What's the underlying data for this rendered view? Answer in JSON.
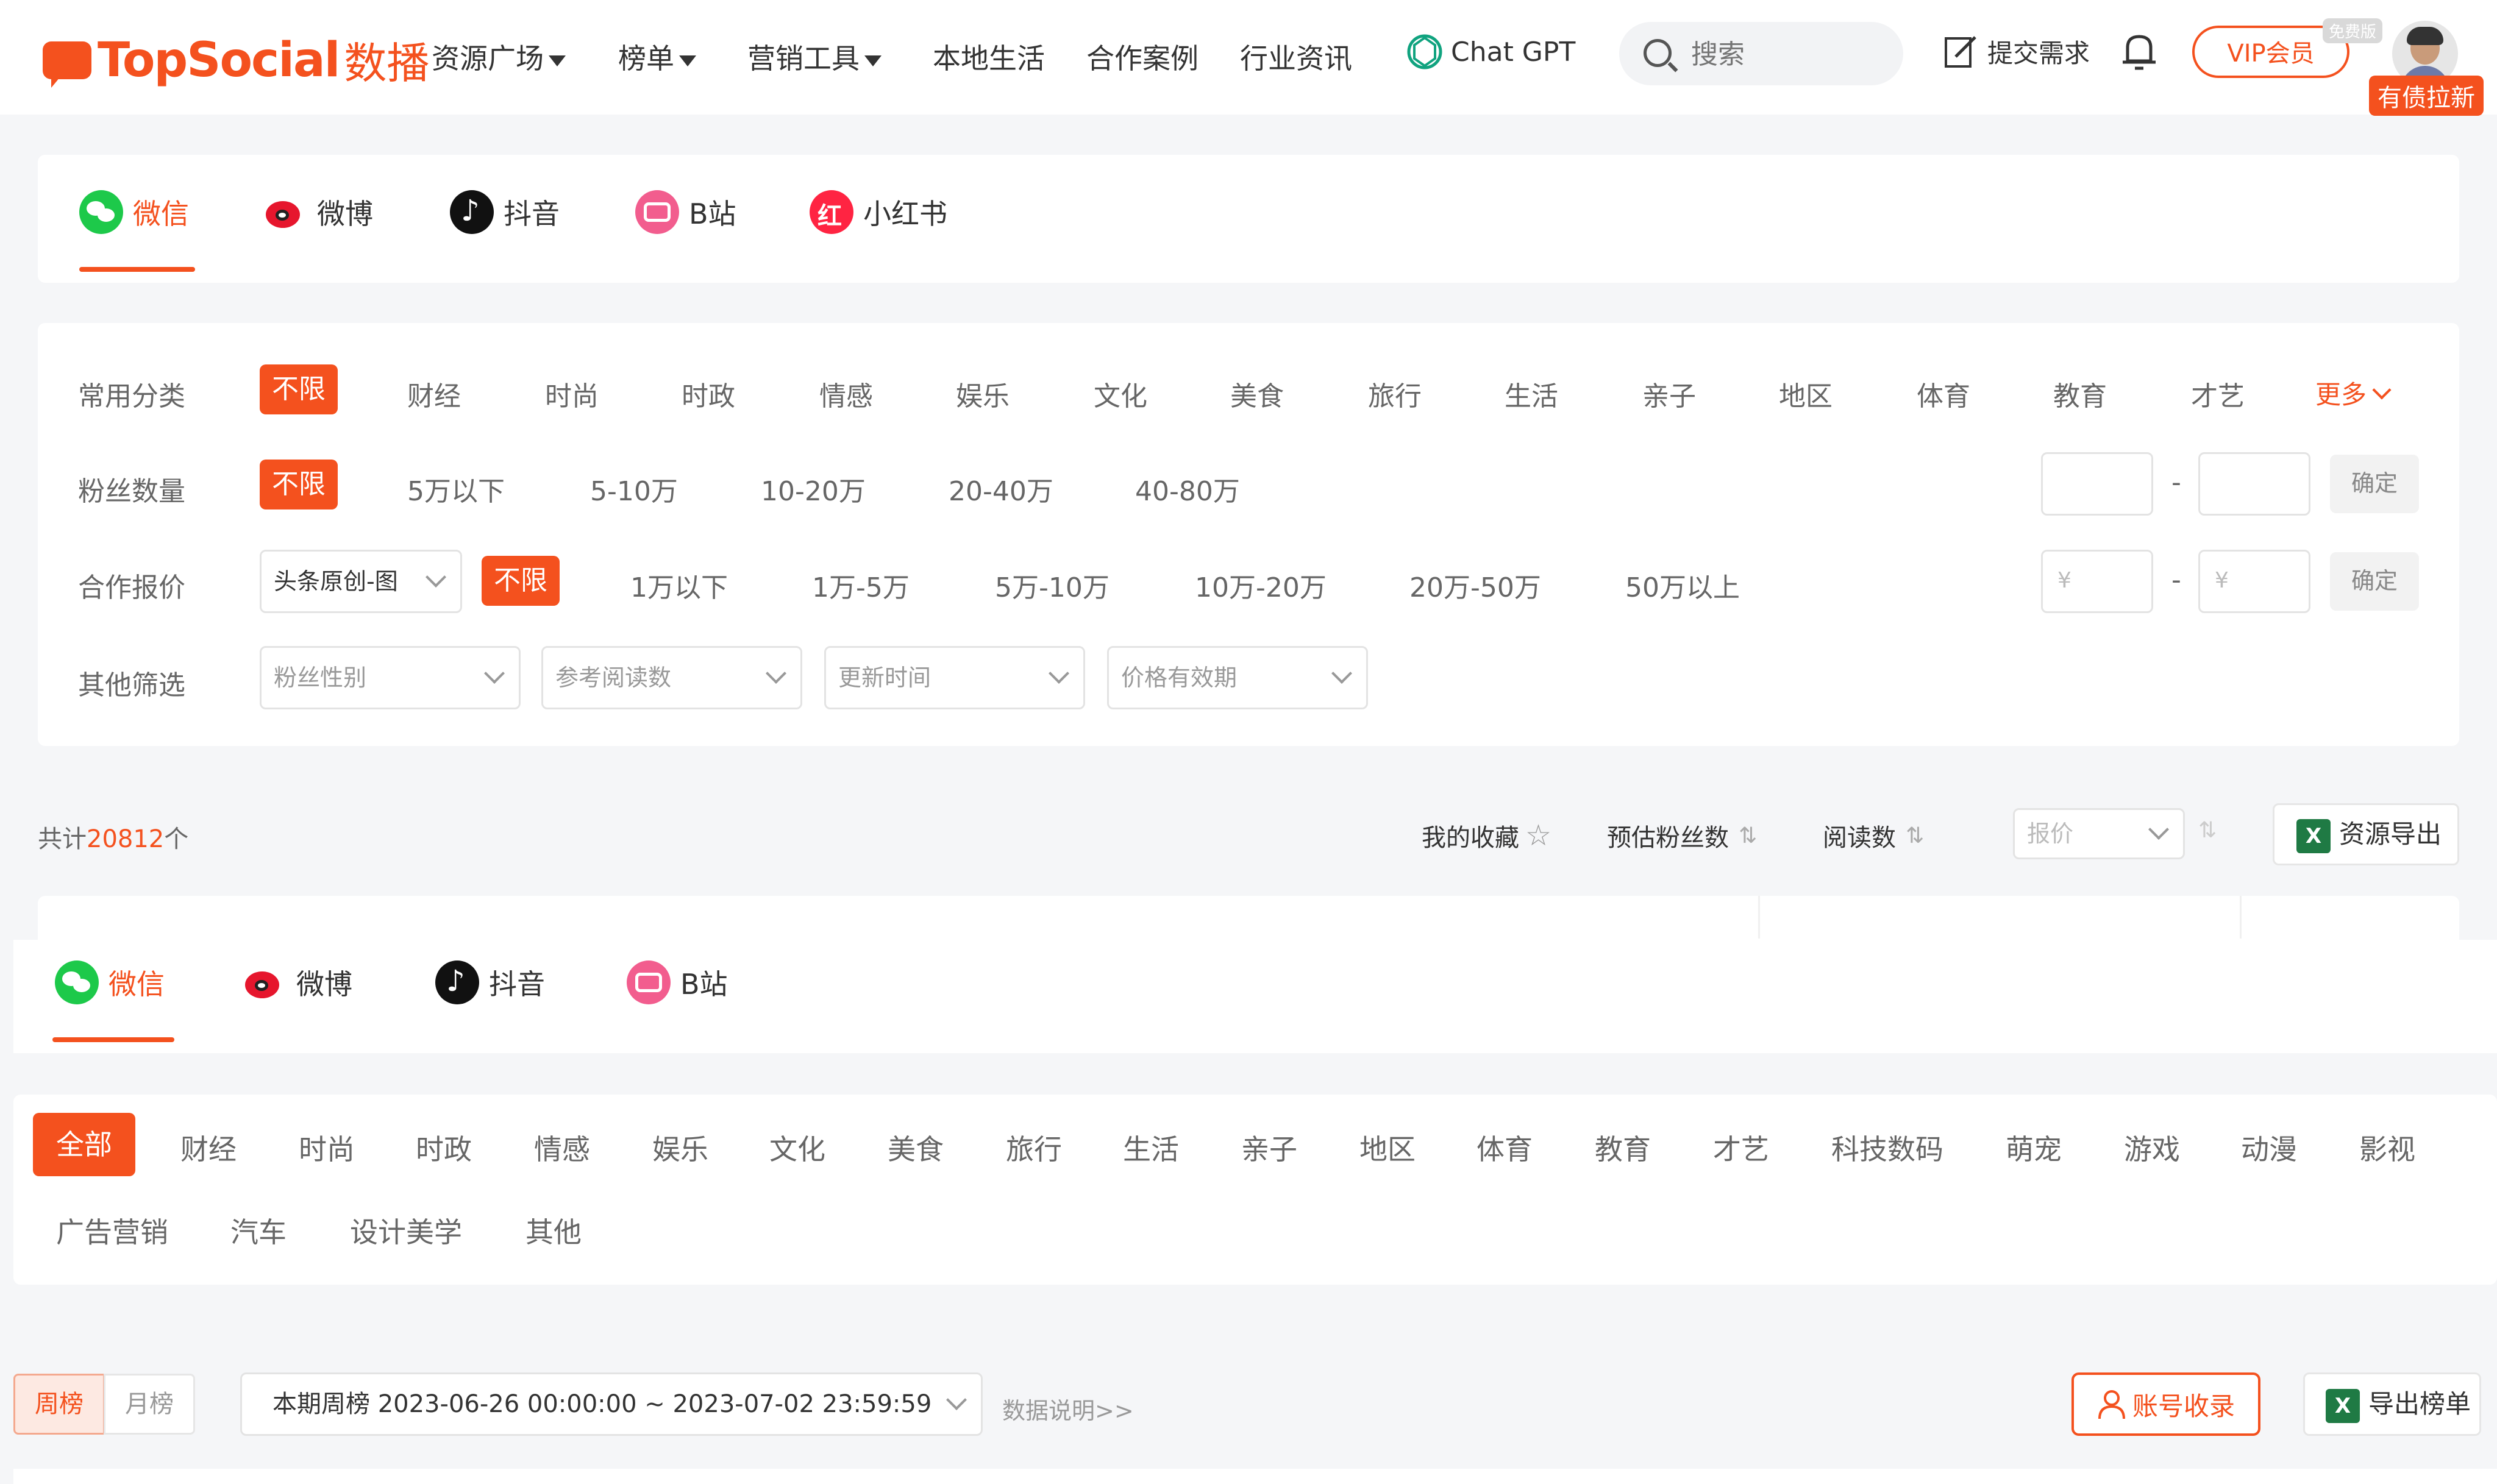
{
  "header": {
    "logo_text": "TopSocial",
    "logo_cn": "数播",
    "nav": [
      {
        "label": "资源广场",
        "caret": true
      },
      {
        "label": "榜单",
        "caret": true
      },
      {
        "label": "营销工具",
        "caret": true
      },
      {
        "label": "本地生活",
        "caret": false
      },
      {
        "label": "合作案例",
        "caret": false
      },
      {
        "label": "行业资讯",
        "caret": false
      }
    ],
    "chatgpt_label": "Chat GPT",
    "search_placeholder": "搜索",
    "submit_label": "提交需求",
    "vip_label": "VIP会员",
    "free_tag": "免费版",
    "user_name": "有债拉新"
  },
  "resource": {
    "platform_tabs": [
      "微信",
      "微博",
      "抖音",
      "B站",
      "小红书"
    ],
    "active_tab": "微信",
    "filters": {
      "category_label": "常用分类",
      "categories": [
        "不限",
        "财经",
        "时尚",
        "时政",
        "情感",
        "娱乐",
        "文化",
        "美食",
        "旅行",
        "生活",
        "亲子",
        "地区",
        "体育",
        "教育",
        "才艺"
      ],
      "more_label": "更多",
      "fans_label": "粉丝数量",
      "fans_options": [
        "不限",
        "5万以下",
        "5-10万",
        "10-20万",
        "20-40万",
        "40-80万"
      ],
      "price_label": "合作报价",
      "price_type": "头条原创-图",
      "price_options": [
        "不限",
        "1万以下",
        "1万-5万",
        "5万-10万",
        "10万-20万",
        "20万-50万",
        "50万以上"
      ],
      "range_sep": "-",
      "yuan_placeholder": "¥",
      "confirm_label": "确定",
      "other_label": "其他筛选",
      "other_dropdowns": [
        "粉丝性别",
        "参考阅读数",
        "更新时间",
        "价格有效期"
      ]
    },
    "results": {
      "total_prefix": "共计",
      "total_count": "20812",
      "total_suffix": "个",
      "favorites_label": "我的收藏",
      "sort_fans": "预估粉丝数",
      "sort_reads": "阅读数",
      "price_select": "报价",
      "export_label": "资源导出"
    }
  },
  "ranking": {
    "platform_tabs": [
      "微信",
      "微博",
      "抖音",
      "B站"
    ],
    "active_tab": "微信",
    "categories": [
      "全部",
      "财经",
      "时尚",
      "时政",
      "情感",
      "娱乐",
      "文化",
      "美食",
      "旅行",
      "生活",
      "亲子",
      "地区",
      "体育",
      "教育",
      "才艺",
      "科技数码",
      "萌宠",
      "游戏",
      "动漫",
      "影视",
      "广告营销",
      "汽车",
      "设计美学",
      "其他"
    ],
    "period_tabs": [
      "周榜",
      "月榜"
    ],
    "period_value": "本期周榜 2023-06-26 00:00:00 ~ 2023-07-02 23:59:59",
    "data_note": "数据说明>>",
    "account_btn": "账号收录",
    "export_btn": "导出榜单"
  },
  "colors": {
    "accent": "#f4511e",
    "wechat": "#1dc94a",
    "weibo": "#e6162d",
    "bilibili": "#f25d8e",
    "xhs": "#ff2442"
  }
}
